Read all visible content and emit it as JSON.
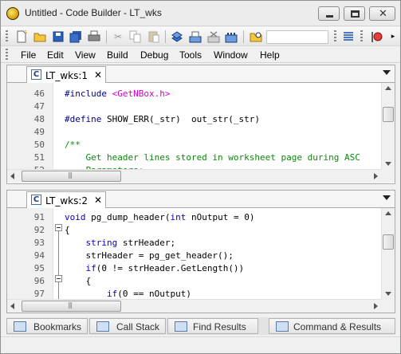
{
  "window": {
    "title": "Untitled - Code Builder - LT_wks",
    "minimize_label": "",
    "maximize_label": "",
    "close_label": "✕"
  },
  "menu": [
    "File",
    "Edit",
    "View",
    "Build",
    "Debug",
    "Tools",
    "Window",
    "Help"
  ],
  "editor_top": {
    "tab_label": "LT_wks:1",
    "tab_close": "✕",
    "tab_icon_text": "C",
    "lines": [
      {
        "no": "46",
        "parts": [
          [
            "dir",
            "#include "
          ],
          [
            "inc",
            "<GetNBox.h>"
          ]
        ]
      },
      {
        "no": "47",
        "parts": []
      },
      {
        "no": "48",
        "parts": [
          [
            "dir",
            "#define "
          ],
          [
            "plain",
            "SHOW_ERR(_str)  out_str(_str)"
          ]
        ]
      },
      {
        "no": "49",
        "parts": []
      },
      {
        "no": "50",
        "parts": [
          [
            "cmt",
            "/**"
          ]
        ]
      },
      {
        "no": "51",
        "parts": [
          [
            "cmt",
            "    Get header lines stored in worksheet page during ASC"
          ]
        ]
      },
      {
        "no": "52",
        "parts": [
          [
            "cmt",
            "    Parameters:"
          ]
        ]
      }
    ]
  },
  "editor_bottom": {
    "tab_label": "LT_wks:2",
    "tab_close": "✕",
    "tab_icon_text": "C",
    "lines": [
      {
        "no": "91",
        "parts": [
          [
            "kw",
            "void "
          ],
          [
            "plain",
            "pg_dump_header("
          ],
          [
            "kw",
            "int "
          ],
          [
            "plain",
            "nOutput = 0)"
          ]
        ]
      },
      {
        "no": "92",
        "parts": [
          [
            "plain",
            "{"
          ]
        ]
      },
      {
        "no": "93",
        "parts": [
          [
            "plain",
            "    "
          ],
          [
            "kw",
            "string "
          ],
          [
            "plain",
            "strHeader;"
          ]
        ]
      },
      {
        "no": "94",
        "parts": [
          [
            "plain",
            "    strHeader = pg_get_header();"
          ]
        ]
      },
      {
        "no": "95",
        "parts": [
          [
            "plain",
            "    "
          ],
          [
            "kw",
            "if"
          ],
          [
            "plain",
            "(0 != strHeader.GetLength())"
          ]
        ]
      },
      {
        "no": "96",
        "parts": [
          [
            "plain",
            "    {"
          ]
        ]
      },
      {
        "no": "97",
        "parts": [
          [
            "plain",
            "        "
          ],
          [
            "kw",
            "if"
          ],
          [
            "plain",
            "(0 == nOutput)"
          ]
        ]
      }
    ]
  },
  "dock_tabs": [
    {
      "label": "Bookmarks",
      "icon": "bookmarks-icon"
    },
    {
      "label": "Call Stack",
      "icon": "call-stack-icon"
    },
    {
      "label": "Find Results",
      "icon": "find-results-icon"
    },
    {
      "label": "Command & Results",
      "icon": "command-results-icon"
    }
  ],
  "colors": {
    "directive": "#00008b",
    "include": "#d000d0",
    "comment": "#0a8a0a",
    "keyword": "#0000c8"
  }
}
